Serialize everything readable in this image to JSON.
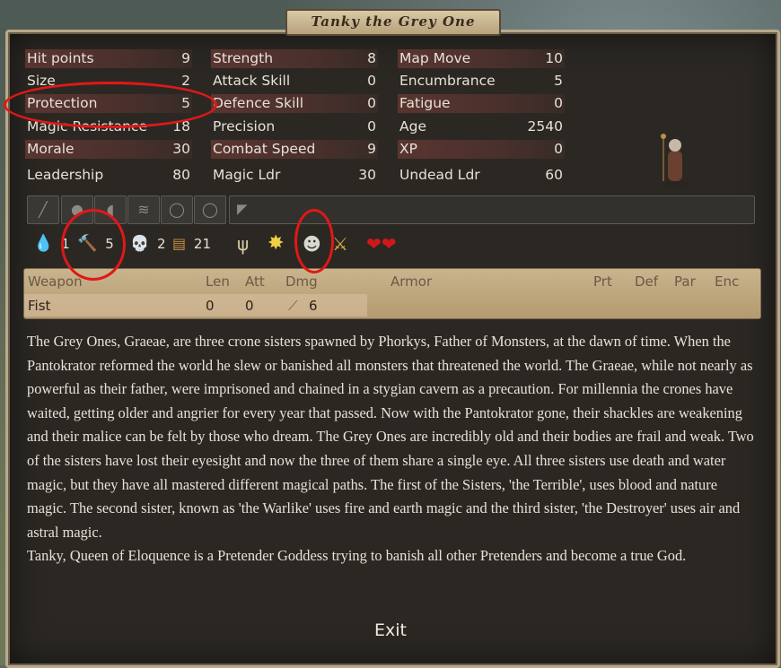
{
  "title": "Tanky the Grey One",
  "stats": {
    "col1": [
      {
        "label": "Hit points",
        "value": "9"
      },
      {
        "label": "Size",
        "value": "2"
      },
      {
        "label": "Protection",
        "value": "5"
      },
      {
        "label": "Magic Resistance",
        "value": "18"
      },
      {
        "label": "Morale",
        "value": "30"
      },
      {
        "label": "Leadership",
        "value": "80"
      }
    ],
    "col2": [
      {
        "label": "Strength",
        "value": "8"
      },
      {
        "label": "Attack Skill",
        "value": "0"
      },
      {
        "label": "Defence Skill",
        "value": "0"
      },
      {
        "label": "Precision",
        "value": "0"
      },
      {
        "label": "Combat Speed",
        "value": "9"
      },
      {
        "label": "Magic Ldr",
        "value": "30"
      }
    ],
    "col3": [
      {
        "label": "Map Move",
        "value": "10"
      },
      {
        "label": "Encumbrance",
        "value": "5"
      },
      {
        "label": "Fatigue",
        "value": "0"
      },
      {
        "label": "Age",
        "value": "2540"
      },
      {
        "label": "XP",
        "value": "0"
      },
      {
        "label": "Undead Ldr",
        "value": "60"
      }
    ]
  },
  "magic": {
    "water": "1",
    "earth": "5",
    "death": "2",
    "gold": "21"
  },
  "weapons": {
    "headers": [
      "Weapon",
      "Len",
      "Att",
      "Dmg",
      "Armor",
      "Prt",
      "Def",
      "Par",
      "Enc"
    ],
    "rows": [
      {
        "name": "Fist",
        "len": "0",
        "att": "0",
        "dmg": "6"
      }
    ]
  },
  "description": [
    "The Grey Ones, Graeae, are three crone sisters spawned by Phorkys, Father of Monsters, at the dawn of time. When the Pantokrator reformed the world he slew or banished all monsters that threatened the world. The Graeae, while not nearly as powerful as their father, were imprisoned and chained in a stygian cavern as a precaution. For millennia the crones have waited, getting older and angrier for every year that passed. Now with the Pantokrator gone, their shackles are weakening and their malice can be felt by those who dream. The Grey Ones are incredibly old and their bodies are frail and weak. Two of the sisters have lost their eyesight and now the three of them share a single eye. All three sisters use death and water magic, but they have all mastered different magical paths. The first of the Sisters, 'the Terrible', uses blood and nature magic. The second sister, known as 'the Warlike' uses fire and earth magic and the third sister, 'the Destroyer' uses air and astral magic.",
    "Tanky, Queen of Eloquence is a Pretender Goddess trying to banish all other Pretenders and become a true God."
  ],
  "exit_label": "Exit",
  "colors": {
    "stat_bar": "#5a3530",
    "highlight_ring": "#e01818",
    "panel_bg": "#2b2824"
  }
}
